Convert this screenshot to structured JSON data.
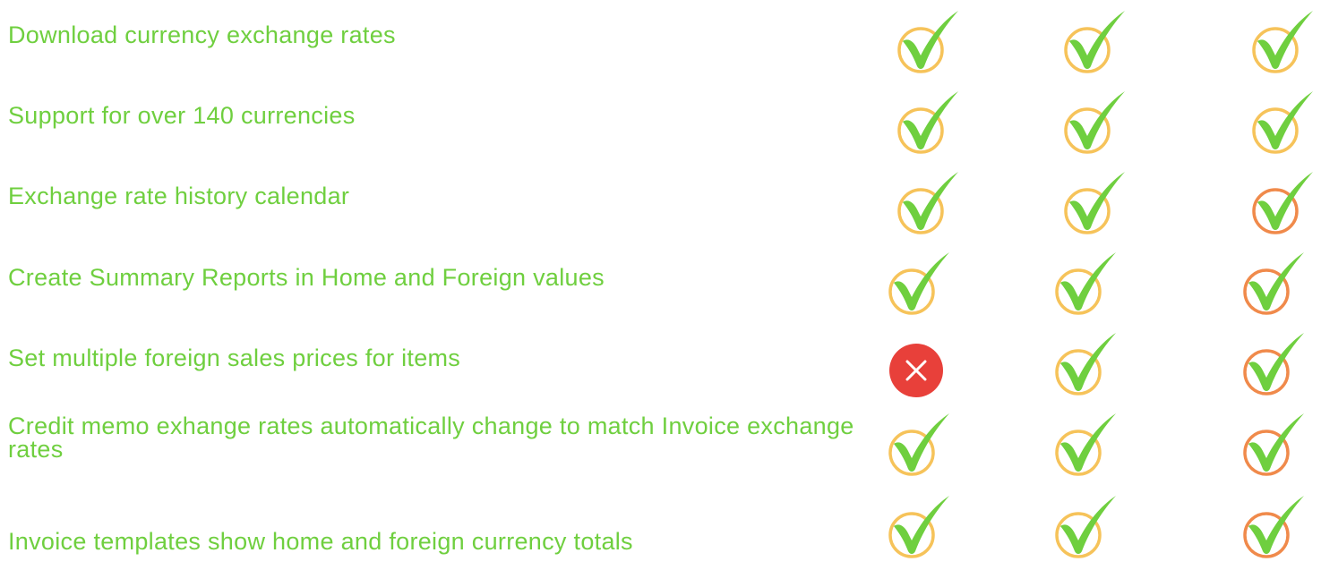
{
  "palette": {
    "text": "#6fcf3f",
    "check": "#6fcf3f",
    "ring_light": "#f6c35a",
    "ring_dark": "#f08a4b",
    "cross_bg": "#e8403a",
    "cross_fg": "#ffffff"
  },
  "rows": [
    {
      "label": "Download currency exchange rates",
      "cells": [
        {
          "icon": "check-icon",
          "ring": "ring_light"
        },
        {
          "icon": "check-icon",
          "ring": "ring_light"
        },
        {
          "icon": "check-icon",
          "ring": "ring_light"
        }
      ]
    },
    {
      "label": "Support for over 140 currencies",
      "cells": [
        {
          "icon": "check-icon",
          "ring": "ring_light"
        },
        {
          "icon": "check-icon",
          "ring": "ring_light"
        },
        {
          "icon": "check-icon",
          "ring": "ring_light"
        }
      ]
    },
    {
      "label": "Exchange rate history calendar",
      "cells": [
        {
          "icon": "check-icon",
          "ring": "ring_light"
        },
        {
          "icon": "check-icon",
          "ring": "ring_light"
        },
        {
          "icon": "check-icon",
          "ring": "ring_dark"
        }
      ]
    },
    {
      "label": "Create Summary Reports in Home and Foreign values",
      "cells": [
        {
          "icon": "check-icon",
          "ring": "ring_light"
        },
        {
          "icon": "check-icon",
          "ring": "ring_light"
        },
        {
          "icon": "check-icon",
          "ring": "ring_dark"
        }
      ]
    },
    {
      "label": "Set multiple foreign sales prices for items",
      "cells": [
        {
          "icon": "cross-icon",
          "ring": "cross_bg"
        },
        {
          "icon": "check-icon",
          "ring": "ring_light"
        },
        {
          "icon": "check-icon",
          "ring": "ring_dark"
        }
      ]
    },
    {
      "label": "Credit memo exhange rates automatically change to match Invoice exchange rates",
      "cells": [
        {
          "icon": "check-icon",
          "ring": "ring_light"
        },
        {
          "icon": "check-icon",
          "ring": "ring_light"
        },
        {
          "icon": "check-icon",
          "ring": "ring_dark"
        }
      ]
    },
    {
      "label": "Invoice templates show home and foreign currency totals",
      "cells": [
        {
          "icon": "check-icon",
          "ring": "ring_light"
        },
        {
          "icon": "check-icon",
          "ring": "ring_light"
        },
        {
          "icon": "check-icon",
          "ring": "ring_dark"
        }
      ]
    }
  ]
}
